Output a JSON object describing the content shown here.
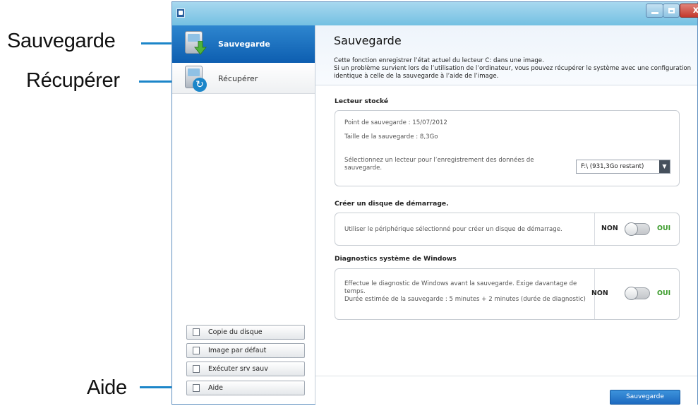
{
  "callouts": {
    "backup": "Sauvegarde",
    "restore": "Récupérer",
    "help": "Aide"
  },
  "window": {
    "close_glyph": "x"
  },
  "sidebar": {
    "items": [
      {
        "label": "Sauvegarde",
        "icon": "backup-icon",
        "active": true
      },
      {
        "label": "Récupérer",
        "icon": "restore-icon",
        "active": false
      }
    ],
    "buttons": [
      {
        "label": "Copie du disque",
        "icon": "disk-copy-icon"
      },
      {
        "label": "Image par défaut",
        "icon": "default-image-icon"
      },
      {
        "label": "Exécuter srv sauv",
        "icon": "run-backup-server-icon"
      },
      {
        "label": "Aide",
        "icon": "help-icon"
      }
    ]
  },
  "main": {
    "title": "Sauvegarde",
    "description": [
      "Cette fonction enregistrer l’état actuel du lecteur C: dans une image.",
      "Si un problème survient lors de l’utilisation de l’ordinateur, vous pouvez récupérer le système avec une configuration",
      "identique à celle de la sauvegarde à l’aide de l’image."
    ]
  },
  "stored_drive": {
    "title": "Lecteur stocké",
    "backup_point": "Point de sauvegarde : 15/07/2012",
    "backup_size": "Taille de la sauvegarde : 8,3Go",
    "select_prompt_line1": "Sélectionnez un lecteur pour l’enregistrement des données de",
    "select_prompt_line2": "sauvegarde.",
    "selected_drive": "F:\\ (931,3Go restant)"
  },
  "boot_disk": {
    "title": "Créer un disque de démarrage.",
    "text": "Utiliser le périphérique sélectionné pour créer un disque de démarrage.",
    "off_label": "NON",
    "on_label": "OUI",
    "enabled": false
  },
  "diagnostics": {
    "title": "Diagnostics système de Windows",
    "line1": "Effectue le diagnostic de Windows avant la sauvegarde. Exige davantage de",
    "line2": "temps.",
    "line3": "Durée estimée de la sauvegarde : 5 minutes + 2 minutes (durée de diagnostic)",
    "off_label": "NON",
    "on_label": "OUI",
    "enabled": false
  },
  "footer": {
    "primary_label": "Sauvegarde"
  },
  "colors": {
    "accent": "#1c86c9",
    "active_nav": "#0d5eb0",
    "on_green": "#3a9b2a"
  }
}
